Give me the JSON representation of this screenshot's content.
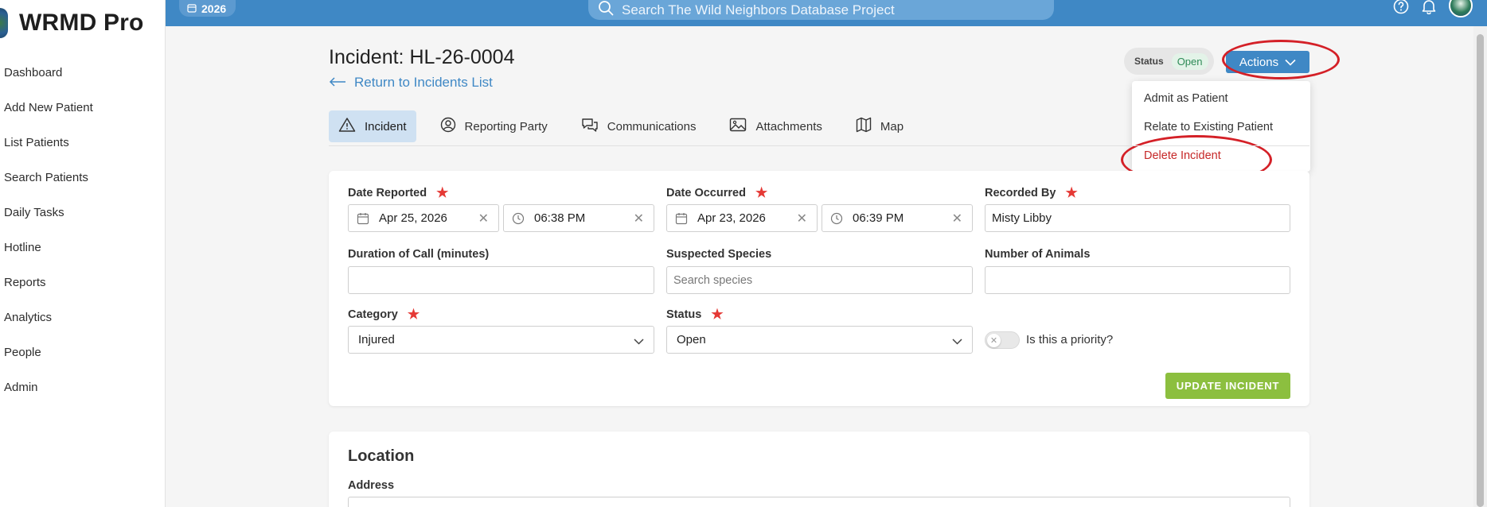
{
  "app": {
    "brand": "WRMD Pro",
    "year": "2026"
  },
  "search": {
    "placeholder": "Search The Wild Neighbors Database Project"
  },
  "sidebar": {
    "items": [
      {
        "label": "Dashboard"
      },
      {
        "label": "Add New Patient"
      },
      {
        "label": "List Patients"
      },
      {
        "label": "Search Patients"
      },
      {
        "label": "Daily Tasks"
      },
      {
        "label": "Hotline"
      },
      {
        "label": "Reports"
      },
      {
        "label": "Analytics"
      },
      {
        "label": "People"
      },
      {
        "label": "Admin"
      }
    ]
  },
  "header": {
    "title": "Incident: HL-26-0004",
    "back_link": "Return to Incidents List",
    "status_label": "Status",
    "status_value": "Open",
    "actions_label": "Actions"
  },
  "actions_menu": {
    "items": [
      {
        "label": "Admit as Patient"
      },
      {
        "label": "Relate to Existing Patient"
      },
      {
        "label": "Delete Incident"
      }
    ]
  },
  "tabs": [
    {
      "label": "Incident",
      "icon": "warning-icon"
    },
    {
      "label": "Reporting Party",
      "icon": "user-circle-icon"
    },
    {
      "label": "Communications",
      "icon": "chat-icon"
    },
    {
      "label": "Attachments",
      "icon": "image-icon"
    },
    {
      "label": "Map",
      "icon": "map-icon"
    }
  ],
  "form": {
    "date_reported": {
      "label": "Date Reported",
      "date": "Apr 25, 2026",
      "time": "06:38 PM"
    },
    "date_occurred": {
      "label": "Date Occurred",
      "date": "Apr 23, 2026",
      "time": "06:39 PM"
    },
    "recorded_by": {
      "label": "Recorded By",
      "value": "Misty Libby"
    },
    "duration": {
      "label": "Duration of Call (minutes)",
      "value": ""
    },
    "species": {
      "label": "Suspected Species",
      "placeholder": "Search species"
    },
    "num_animals": {
      "label": "Number of Animals",
      "value": ""
    },
    "category": {
      "label": "Category",
      "value": "Injured"
    },
    "status": {
      "label": "Status",
      "value": "Open"
    },
    "priority": {
      "label": "Is this a priority?",
      "enabled": false
    },
    "submit_label": "UPDATE INCIDENT"
  },
  "location": {
    "title": "Location",
    "address_label": "Address"
  },
  "colors": {
    "topbar": "#3f88c5",
    "primary": "#3f88c5",
    "success_button": "#8cbf3f",
    "danger": "#c62828",
    "annotation": "#d42027"
  }
}
